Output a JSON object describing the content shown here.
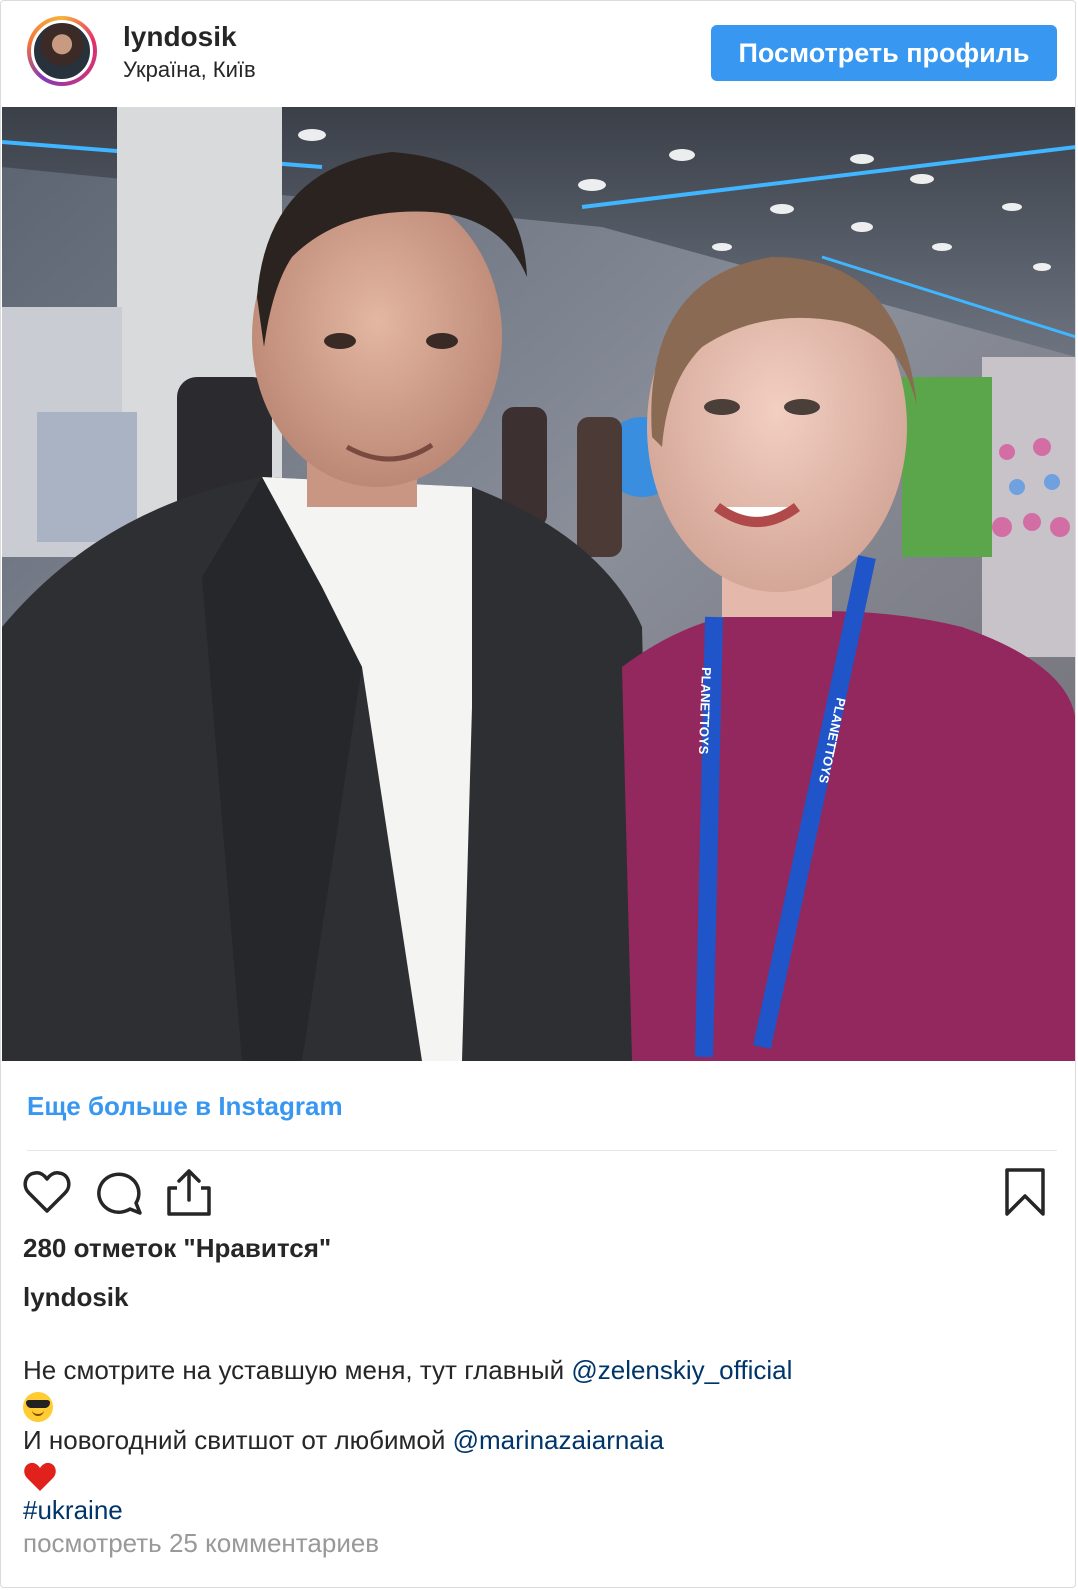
{
  "header": {
    "username": "lyndosik",
    "location": "Україна, Київ",
    "view_profile_label": "Посмотреть профиль"
  },
  "photo": {
    "lanyard_text": "PLANETTOYS"
  },
  "more_link": "Еще больше в Instagram",
  "actions": {
    "like_icon": "heart-outline-icon",
    "comment_icon": "speech-bubble-icon",
    "share_icon": "share-upload-icon",
    "save_icon": "bookmark-icon"
  },
  "likes_text": "280 отметок \"Нравится\"",
  "caption": {
    "username": "lyndosik",
    "line1_text": "Не смотрите на уставшую меня, тут главный ",
    "mention1": "@zelenskiy_official",
    "emoji1": "sunglasses-emoji",
    "line3_text": "И новогодний свитшот от любимой ",
    "mention2": "@marinazaiarnaia",
    "emoji2": "red-heart-emoji",
    "hashtag": "#ukraine"
  },
  "comments_link": "посмотреть 25 комментариев",
  "colors": {
    "accent": "#3897f0",
    "mention": "#003569",
    "muted": "#999999"
  }
}
